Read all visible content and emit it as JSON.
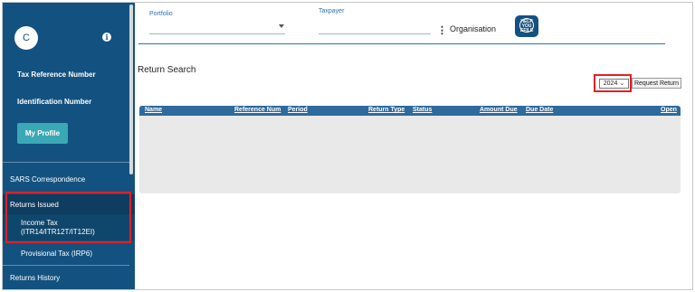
{
  "sidebar": {
    "avatar_initial": "C",
    "info_icon": "i",
    "tax_reference_label": "Tax Reference Number",
    "identification_label": "Identification Number",
    "profile_button": "My Profile",
    "nav": {
      "sars_correspondence": "SARS Correspondence",
      "returns_issued": "Returns Issued",
      "income_tax_line1": "Income Tax",
      "income_tax_line2": "(ITR14/ITR12T/IT12EI)",
      "provisional_tax": "Provisional Tax (IRP6)",
      "returns_history": "Returns History"
    }
  },
  "header": {
    "portfolio_label": "Portfolio",
    "portfolio_value": "",
    "taxpayer_label": "Taxpayer",
    "taxpayer_value": "",
    "kebab": "⋮",
    "organisation_label": "Organisation",
    "help_logo_text": "HELP YOU EFILE"
  },
  "main": {
    "title": "Return Search",
    "year_select": {
      "value": "2024",
      "arrow": "⌄"
    },
    "request_button": "Request Return",
    "table": {
      "columns": [
        "Name",
        "Reference Num",
        "Period",
        "Return Type",
        "Status",
        "Amount Due",
        "Due Date",
        "Open"
      ],
      "rows": []
    }
  },
  "colors": {
    "sidebar": "#135280",
    "accent": "#3aa8b5",
    "table_header": "#2e6a9c",
    "highlight": "#e21f26"
  }
}
